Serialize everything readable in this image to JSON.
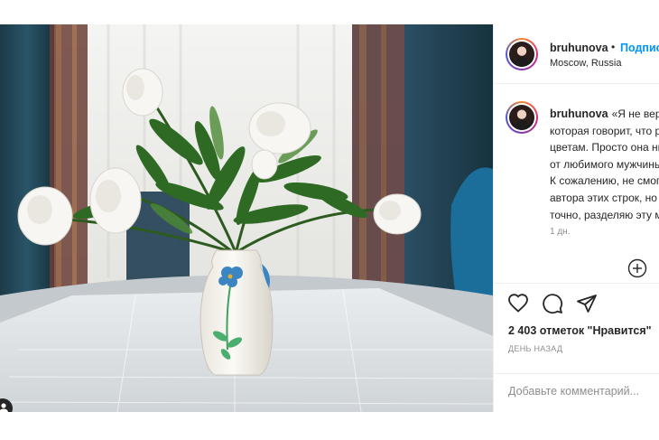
{
  "post": {
    "username": "bruhunova",
    "separator": "•",
    "follow_label": "Подписаться",
    "location": "Moscow, Russia",
    "caption_lines": [
      "«Я не верю женщине,",
      "которая говорит, что равнодушна к",
      "цветам. Просто она никогда не получала их",
      "от любимого мужчины».",
      "К сожалению, не смогла найти",
      "автора этих строк, но это",
      "точно, разделяю эту мысль."
    ],
    "age": "1 дн.",
    "likes": "2 403 отметок \"Нравится\"",
    "time_ago": "ДЕНЬ НАЗАД",
    "comment_placeholder": "Добавьте комментарий..."
  },
  "icons": {
    "like": "heart-icon",
    "comment": "speech-bubble-icon",
    "share": "paper-plane-icon",
    "new_comment": "plus-circle-icon",
    "tags": "user-tag-icon"
  },
  "colors": {
    "accent": "#0095f6",
    "text": "#262626",
    "muted": "#8e8e8e",
    "divider": "#efefef"
  }
}
